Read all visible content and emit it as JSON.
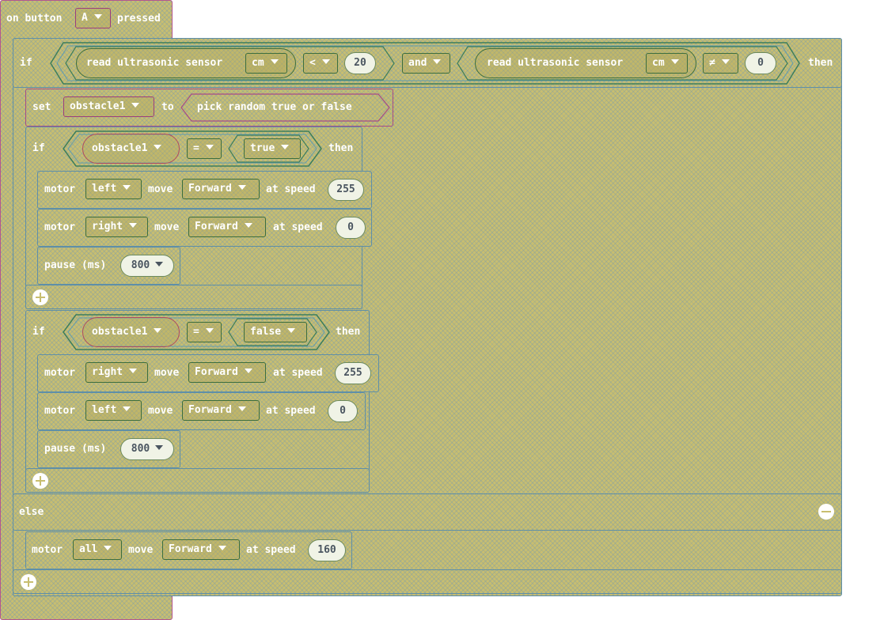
{
  "event": {
    "label_on": "on button",
    "button": "A",
    "label_pressed": "pressed"
  },
  "outer_if": {
    "if": "if",
    "cond": {
      "left": {
        "label": "read ultrasonic sensor",
        "unit": "cm",
        "op": "<",
        "value": "20"
      },
      "joiner": "and",
      "right": {
        "label": "read ultrasonic sensor",
        "unit": "cm",
        "op": "≠",
        "value": "0"
      }
    },
    "then": "then",
    "else": "else"
  },
  "set_block": {
    "label": "set",
    "var": "obstacle1",
    "to": "to",
    "value": "pick random true or false"
  },
  "if1": {
    "if": "if",
    "var": "obstacle1",
    "op": "=",
    "value": "true",
    "then": "then"
  },
  "if2": {
    "if": "if",
    "var": "obstacle1",
    "op": "=",
    "value": "false",
    "then": "then"
  },
  "motors": {
    "m1": {
      "label": "motor",
      "side": "left",
      "move": "move",
      "dir": "Forward",
      "at": "at speed",
      "speed": "255"
    },
    "m2": {
      "label": "motor",
      "side": "right",
      "move": "move",
      "dir": "Forward",
      "at": "at speed",
      "speed": "0"
    },
    "m3": {
      "label": "motor",
      "side": "right",
      "move": "move",
      "dir": "Forward",
      "at": "at speed",
      "speed": "255"
    },
    "m4": {
      "label": "motor",
      "side": "left",
      "move": "move",
      "dir": "Forward",
      "at": "at speed",
      "speed": "0"
    },
    "m5": {
      "label": "motor",
      "side": "all",
      "move": "move",
      "dir": "Forward",
      "at": "at speed",
      "speed": "160"
    }
  },
  "pause1": {
    "label": "pause (ms)",
    "value": "800"
  },
  "pause2": {
    "label": "pause (ms)",
    "value": "800"
  },
  "icons": {
    "plus": "plus-circle-icon",
    "minus": "minus-circle-icon"
  },
  "colors": {
    "block": "#c8be70",
    "outline": "#5e8fa8",
    "event_outline": "#b3568e",
    "number_bg": "#f0f3e6"
  }
}
